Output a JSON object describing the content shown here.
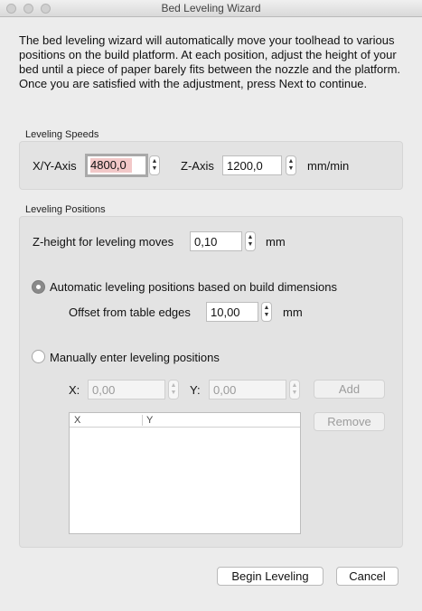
{
  "window": {
    "title": "Bed Leveling Wizard"
  },
  "intro": "The bed leveling wizard will automatically move your toolhead to various positions on the build platform.  At each position, adjust the height of your bed until a piece of paper barely fits between the nozzle and the platform.  Once you are satisfied with the adjustment, press Next to continue.",
  "speeds": {
    "group_label": "Leveling Speeds",
    "xy_label": "X/Y-Axis",
    "xy_value": "4800,0",
    "z_label": "Z-Axis",
    "z_value": "1200,0",
    "unit": "mm/min"
  },
  "positions": {
    "group_label": "Leveling Positions",
    "zheight_label": "Z-height for leveling moves",
    "zheight_value": "0,10",
    "zheight_unit": "mm",
    "auto_label": "Automatic leveling positions based on build dimensions",
    "offset_label": "Offset from table edges",
    "offset_value": "10,00",
    "offset_unit": "mm",
    "manual_label": "Manually enter leveling positions",
    "x_label": "X:",
    "x_value": "0,00",
    "y_label": "Y:",
    "y_value": "0,00",
    "add_label": "Add",
    "remove_label": "Remove",
    "columns": [
      "X",
      "Y"
    ]
  },
  "buttons": {
    "begin": "Begin Leveling",
    "cancel": "Cancel"
  },
  "icons": {
    "stepper": "stepper-arrows-icon",
    "window_controls": "traffic-light-icon"
  }
}
